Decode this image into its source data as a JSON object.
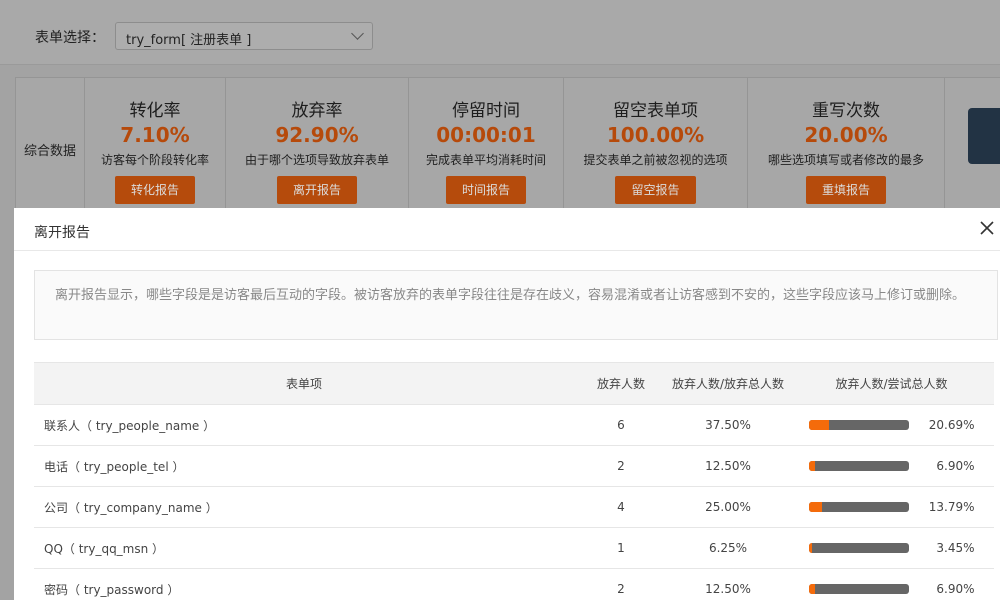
{
  "filter": {
    "label": "表单选择：",
    "selected": "try_form[ 注册表单 ]"
  },
  "summary": {
    "label": "综合数据",
    "cards": [
      {
        "title": "转化率",
        "value": "7.10%",
        "desc": "访客每个阶段转化率",
        "button": "转化报告"
      },
      {
        "title": "放弃率",
        "value": "92.90%",
        "desc": "由于哪个选项导致放弃表单",
        "button": "离开报告"
      },
      {
        "title": "停留时间",
        "value": "00:00:01",
        "desc": "完成表单平均消耗时间",
        "button": "时间报告"
      },
      {
        "title": "留空表单项",
        "value": "100.00%",
        "desc": "提交表单之前被忽视的选项",
        "button": "留空报告"
      },
      {
        "title": "重写次数",
        "value": "20.00%",
        "desc": "哪些选项填写或者修改的最多",
        "button": "重填报告"
      }
    ]
  },
  "modal": {
    "title": "离开报告",
    "notice": "离开报告显示，哪些字段是是访客最后互动的字段。被访客放弃的表单字段往往是存在歧义，容易混淆或者让访客感到不安的，这些字段应该马上修订或删除。",
    "columns": [
      "表单项",
      "放弃人数",
      "放弃人数/放弃总人数",
      "放弃人数/尝试总人数"
    ],
    "rows": [
      {
        "field": "联系人（ try_people_name ）",
        "count": "6",
        "ratio": "37.50%",
        "attempt_pct": "20.69%",
        "attempt_value": 0.2069
      },
      {
        "field": "电话（ try_people_tel ）",
        "count": "2",
        "ratio": "12.50%",
        "attempt_pct": "6.90%",
        "attempt_value": 0.069
      },
      {
        "field": "公司（ try_company_name ）",
        "count": "4",
        "ratio": "25.00%",
        "attempt_pct": "13.79%",
        "attempt_value": 0.1379
      },
      {
        "field": "QQ（ try_qq_msn ）",
        "count": "1",
        "ratio": "6.25%",
        "attempt_pct": "3.45%",
        "attempt_value": 0.0345
      },
      {
        "field": "密码（ try_password ）",
        "count": "2",
        "ratio": "12.50%",
        "attempt_pct": "6.90%",
        "attempt_value": 0.069
      }
    ]
  },
  "colors": {
    "accent": "#f46b0b",
    "bar_track": "#666666",
    "value_text": "#b64a0b"
  }
}
